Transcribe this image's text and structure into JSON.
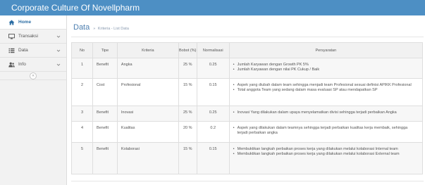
{
  "app": {
    "title": "Corporate Culture Of Novellpharm"
  },
  "sidebar": {
    "items": [
      {
        "label": "Home",
        "icon": "home-icon",
        "active": true
      },
      {
        "label": "Transaksi",
        "icon": "monitor-icon"
      },
      {
        "label": "Data",
        "icon": "list-icon"
      },
      {
        "label": "Info",
        "icon": "users-icon"
      }
    ],
    "collapse_symbol": "«"
  },
  "page": {
    "title": "Data",
    "breadcrumb": [
      "Kriteria",
      "List Data"
    ]
  },
  "table": {
    "columns": {
      "no": "No",
      "tipe": "Tipe",
      "kriteria": "Kriteria",
      "bobot": "Bobot (%)",
      "normalisasi": "Normalisasi",
      "persyaratan": "Persyaratan"
    },
    "rows": [
      {
        "no": "1",
        "tipe": "Benefit",
        "kriteria": "Angka",
        "bobot": "25 %",
        "normalisasi": "0.25",
        "persyaratan": [
          "Jumlah Karyawan dengan Growth PK 5%",
          "Jumlah Karyawan dengan nilai PK Cukup / Baik"
        ]
      },
      {
        "no": "2",
        "tipe": "Cost",
        "kriteria": "Profesional",
        "bobot": "15 %",
        "normalisasi": "0.15",
        "persyaratan": [
          "Aspek yang diubah dalam team sehingga menjadi team Profesional sesuai definisi APIKK Profesional",
          "Total anggota Team yang sedang dalam masa evaluasi SP atau mendapatkan SP"
        ]
      },
      {
        "no": "3",
        "tipe": "Benefit",
        "kriteria": "Inovasi",
        "bobot": "25 %",
        "normalisasi": "0.25",
        "persyaratan": [
          "Inovasi Yang dilakukan dalam upaya menyelamatkan divisi sehingga terjadi perbaikan Angka"
        ]
      },
      {
        "no": "4",
        "tipe": "Benefit",
        "kriteria": "Kualitas",
        "bobot": "20 %",
        "normalisasi": "0.2",
        "persyaratan": [
          "Aspek yang dilakukan dalam teamnya sehingga terjadi perbaikan kualitas kerja membaik, sehingga terjadi perbaikan angka"
        ]
      },
      {
        "no": "5",
        "tipe": "Benefit",
        "kriteria": "Kolaborasi",
        "bobot": "15 %",
        "normalisasi": "0.15",
        "persyaratan": [
          "Membuktikan langkah perbaikan proses kerja yang dilakukan melalui kolaborasi Internal team",
          "Membuktikan langkah perbaikan proses kerja yang dilakukan melalui kolaborasi External team"
        ]
      }
    ]
  },
  "colors": {
    "topbar": "#4d8fc4",
    "accent": "#2a6ca3",
    "title": "#4d7fb0"
  }
}
